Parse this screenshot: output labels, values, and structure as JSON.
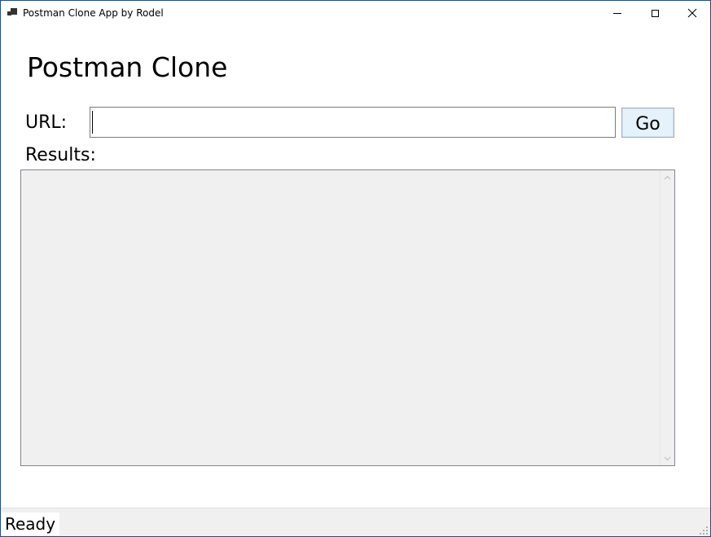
{
  "window": {
    "title": "Postman Clone App by Rodel",
    "icon": "app-window-icon",
    "controls": [
      "minimize-icon",
      "maximize-icon",
      "close-icon"
    ]
  },
  "main": {
    "heading": "Postman Clone",
    "url_label": "URL:",
    "url_value": "",
    "go_label": "Go",
    "results_label": "Results:",
    "results_text": ""
  },
  "statusbar": {
    "status": "Ready"
  }
}
